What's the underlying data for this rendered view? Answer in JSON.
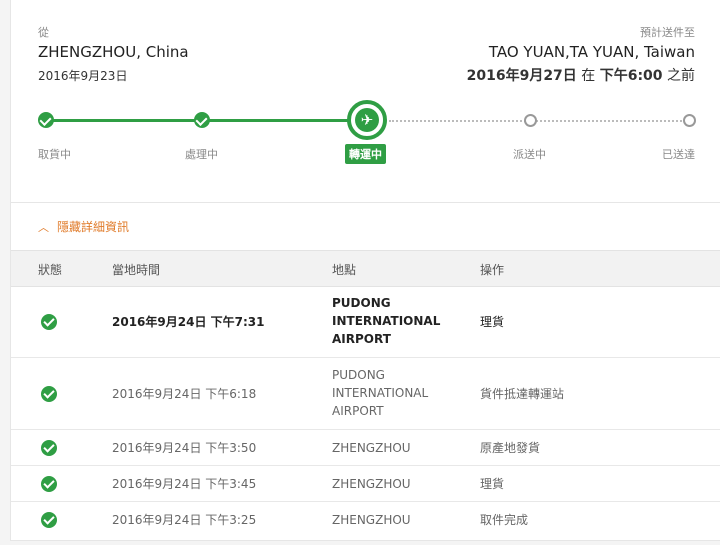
{
  "origin": {
    "label": "從",
    "city": "ZHENGZHOU, China",
    "date": "2016年9月23日"
  },
  "destination": {
    "label": "預計送件至",
    "city": "TAO YUAN,TA YUAN, Taiwan",
    "date_part": "2016年9月27日",
    "at": " 在 ",
    "time_part": "下午6:00",
    "before": " 之前"
  },
  "progress": {
    "steps": [
      "取貨中",
      "處理中",
      "轉運中",
      "派送中",
      "已送達"
    ],
    "current_index": 2,
    "current_icon": "airplane-icon"
  },
  "details_toggle": {
    "label": "隱藏詳細資訊",
    "icon": "chevron-up-icon"
  },
  "table": {
    "headers": {
      "status": "狀態",
      "time": "當地時間",
      "location": "地點",
      "action": "操作"
    },
    "rows": [
      {
        "time": "2016年9月24日 下午7:31",
        "location": "PUDONG INTERNATIONAL AIRPORT",
        "action": "理貨"
      },
      {
        "time": "2016年9月24日 下午6:18",
        "location": "PUDONG INTERNATIONAL AIRPORT",
        "action": "貨件抵達轉運站"
      },
      {
        "time": "2016年9月24日 下午3:50",
        "location": "ZHENGZHOU",
        "action": "原產地發貨"
      },
      {
        "time": "2016年9月24日 下午3:45",
        "location": "ZHENGZHOU",
        "action": "理貨"
      },
      {
        "time": "2016年9月24日 下午3:25",
        "location": "ZHENGZHOU",
        "action": "取件完成"
      }
    ]
  },
  "colors": {
    "accent_green": "#2f9e44",
    "link_orange": "#e07b2a"
  }
}
